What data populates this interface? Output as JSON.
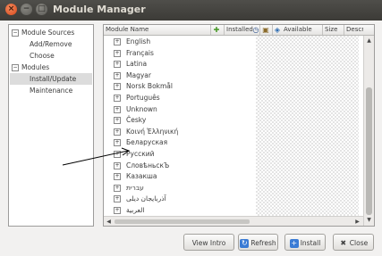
{
  "window": {
    "title": "Module Manager"
  },
  "sidebar": {
    "items": [
      {
        "label": "Module Sources",
        "expander": "−"
      },
      {
        "label": "Add/Remove"
      },
      {
        "label": "Choose"
      },
      {
        "label": "Modules",
        "expander": "−"
      },
      {
        "label": "Install/Update",
        "selected": true
      },
      {
        "label": "Maintenance"
      }
    ]
  },
  "table": {
    "columns": {
      "module_name": "Module Name",
      "installed": "Installed",
      "available": "Available",
      "size": "Size",
      "description": "Descr"
    },
    "expander_glyph": "+",
    "rows": [
      "English",
      "Français",
      "Latina",
      "Magyar",
      "Norsk Bokmål",
      "Português",
      "Unknown",
      "Česky",
      "Κοινή Ἑλληνική",
      "Беларуская",
      "Русский",
      "СловѣньскЪ",
      "Казакша",
      "עברית",
      "آذربایجان دیلی",
      "العربية"
    ]
  },
  "buttons": {
    "view_intro": "View Intro",
    "refresh": "Refresh",
    "install": "Install",
    "close": "Close"
  },
  "colors": {
    "titlebar": "#3c3b37",
    "close_button": "#d9481c",
    "selection": "#dcdcdc"
  },
  "icons": {
    "header_add": "plus-icon",
    "header_installed": "clock-icon",
    "header_lock": "lock-icon",
    "header_available": "available-icon",
    "refresh": "refresh-icon",
    "install": "install-icon",
    "close": "close-icon"
  }
}
